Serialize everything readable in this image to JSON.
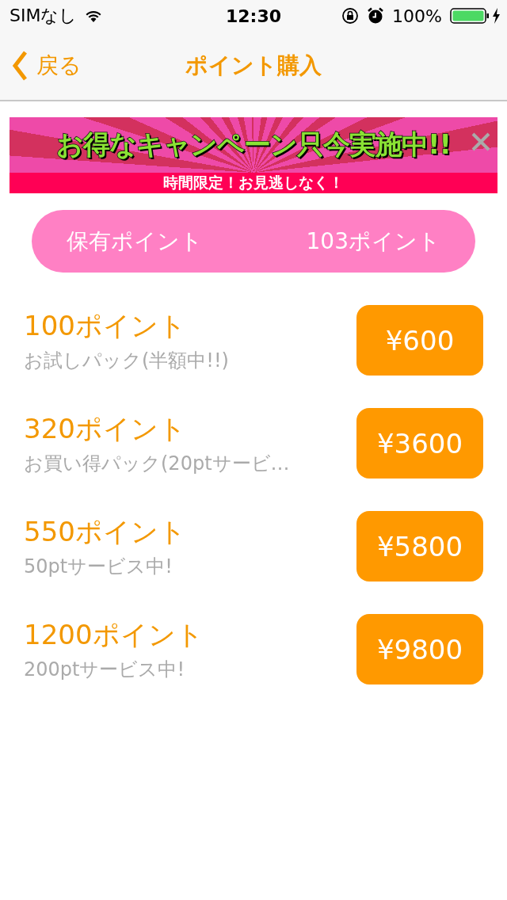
{
  "status_bar": {
    "carrier": "SIMなし",
    "time": "12:30",
    "battery_percent": "100%"
  },
  "nav": {
    "back": "戻る",
    "title": "ポイント購入"
  },
  "banner": {
    "headline": "お得なキャンペーン只今実施中!!",
    "subline": "時間限定！お見逃しなく！"
  },
  "balance": {
    "label": "保有ポイント",
    "value": "103ポイント"
  },
  "packs": [
    {
      "title": "100ポイント",
      "subtitle": "お試しパック(半額中!!)",
      "price": "¥600"
    },
    {
      "title": "320ポイント",
      "subtitle": "お買い得パック(20ptサービ…",
      "price": "¥3600"
    },
    {
      "title": "550ポイント",
      "subtitle": "50ptサービス中!",
      "price": "¥5800"
    },
    {
      "title": "1200ポイント",
      "subtitle": "200ptサービス中!",
      "price": "¥9800"
    }
  ]
}
